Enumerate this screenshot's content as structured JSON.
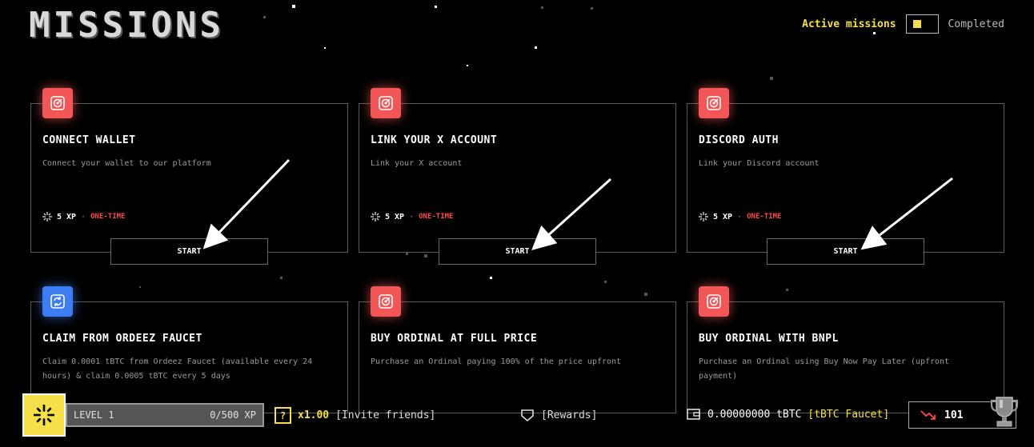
{
  "page": {
    "title": "MISSIONS"
  },
  "toggle": {
    "active_label": "Active missions",
    "completed_label": "Completed",
    "active_on": true
  },
  "missions": [
    {
      "title": "CONNECT WALLET",
      "description": "Connect your wallet to our platform",
      "xp": "5 XP",
      "type": "ONE-TIME",
      "button": "START",
      "icon": "target-icon",
      "color": "#f25656"
    },
    {
      "title": "LINK YOUR X ACCOUNT",
      "description": "Link your X account",
      "xp": "5 XP",
      "type": "ONE-TIME",
      "button": "START",
      "icon": "target-icon",
      "color": "#f25656"
    },
    {
      "title": "DISCORD AUTH",
      "description": "Link your Discord account",
      "xp": "5 XP",
      "type": "ONE-TIME",
      "button": "START",
      "icon": "target-icon",
      "color": "#f25656"
    },
    {
      "title": "CLAIM FROM ORDEEZ FAUCET",
      "description": "Claim 0.0001 tBTC from Ordeez Faucet (available every 24 hours) & claim 0.0005 tBTC every 5 days",
      "icon": "refresh-icon",
      "color": "#3d7cf2"
    },
    {
      "title": "BUY ORDINAL AT FULL PRICE",
      "description": "Purchase an Ordinal paying 100% of the price upfront",
      "icon": "target-icon",
      "color": "#f25656"
    },
    {
      "title": "BUY ORDINAL WITH BNPL",
      "description": "Purchase an Ordinal using Buy Now Pay Later (upfront payment)",
      "icon": "target-icon",
      "color": "#f25656"
    }
  ],
  "footer": {
    "level_label": "LEVEL 1",
    "xp_progress": "0/500 XP",
    "xp_fraction": 0,
    "multiplier": "x1.00",
    "multiplier_icon": "?",
    "invite": "[Invite friends]",
    "rewards": "[Rewards]",
    "balance": "0.00000000 tBTC",
    "faucet": "[tBTC Faucet]",
    "rank": "101"
  },
  "colors": {
    "accent": "#f5e04a",
    "danger": "#ff4a4a",
    "mission_red": "#f25656",
    "mission_blue": "#3d7cf2"
  }
}
